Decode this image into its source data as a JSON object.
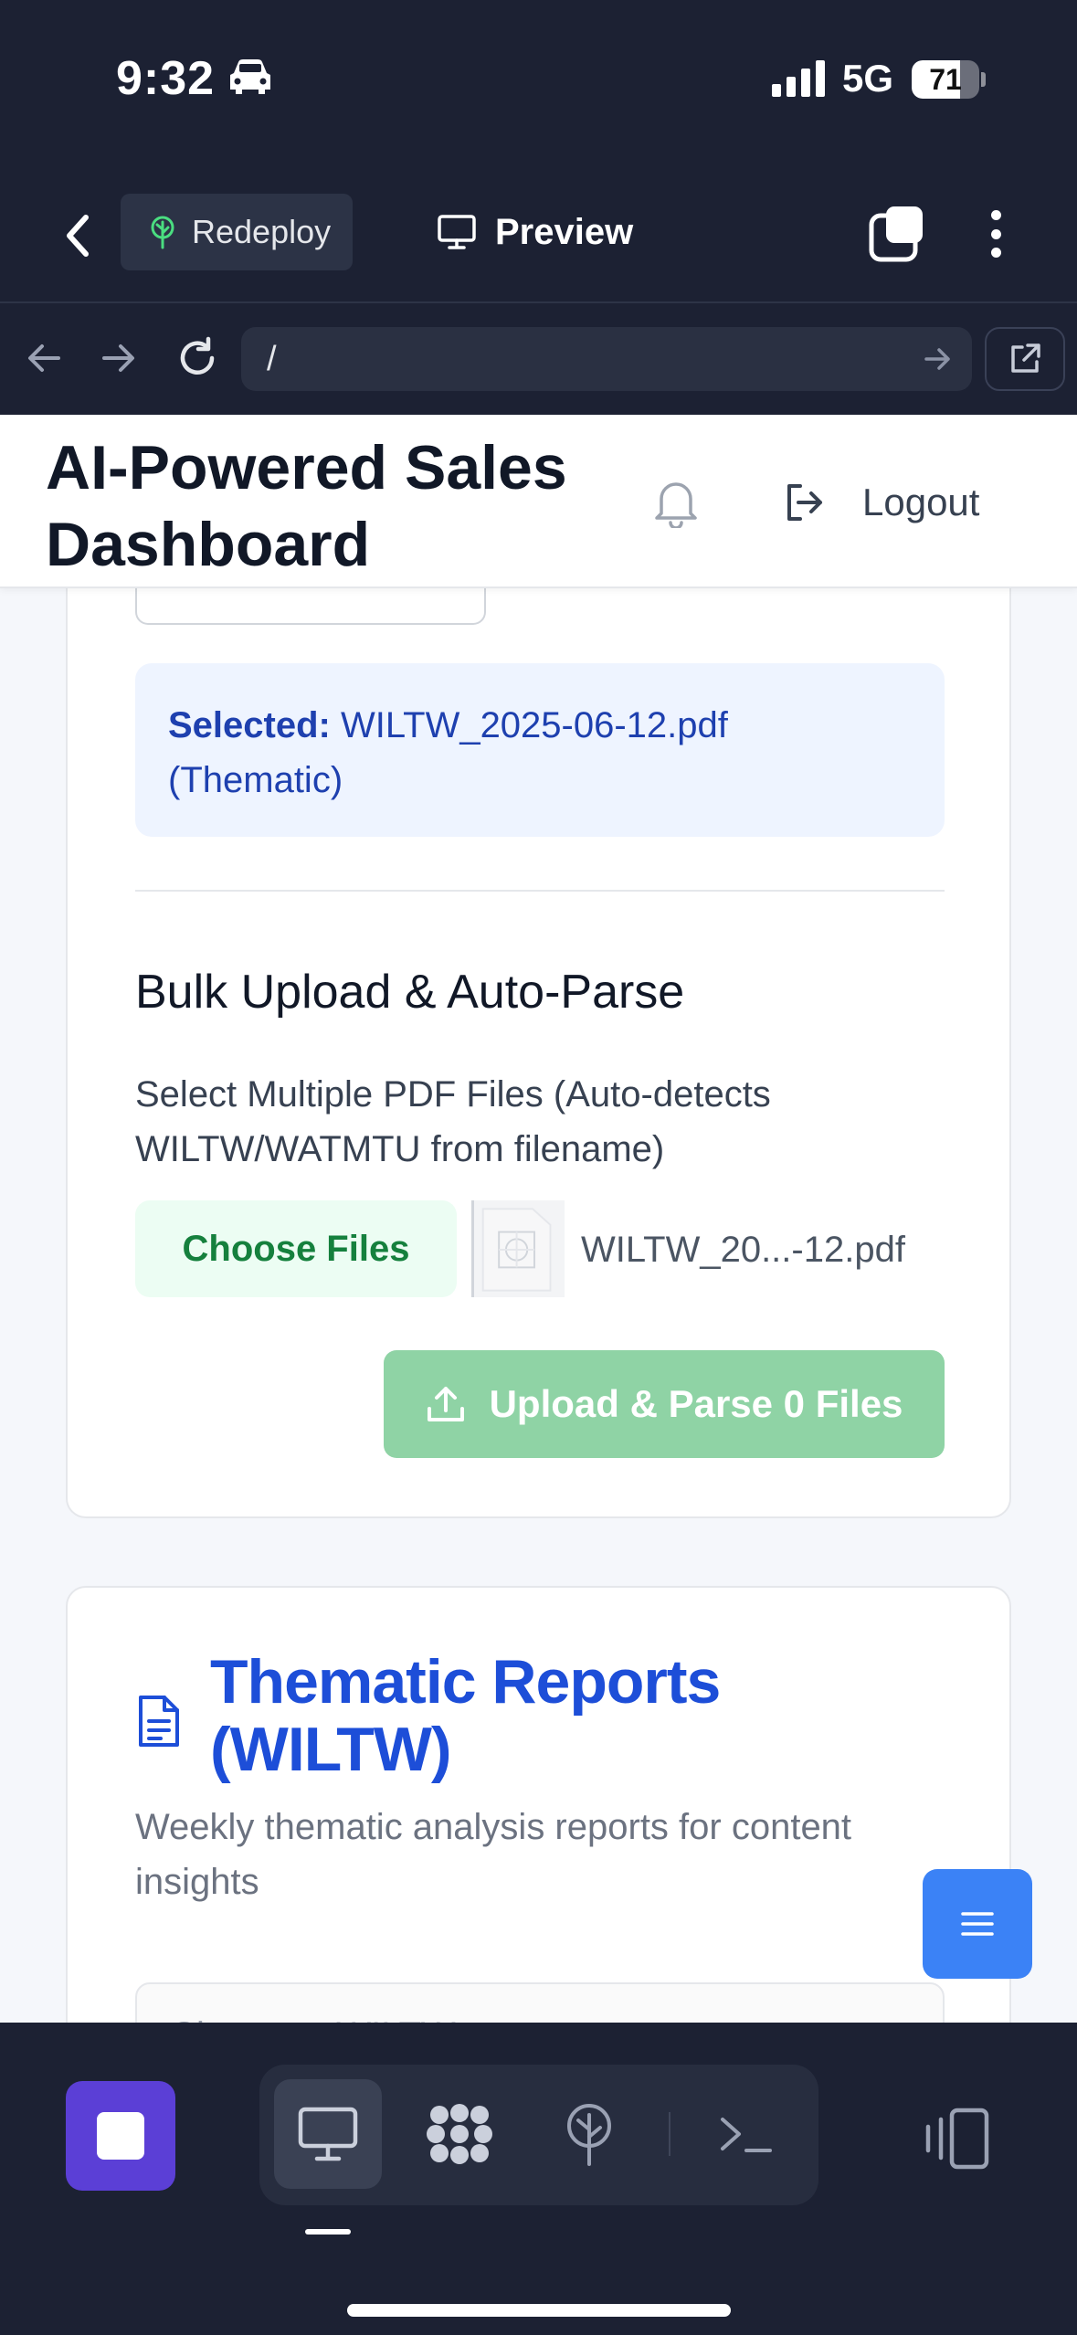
{
  "status_bar": {
    "time": "9:32",
    "network": "5G",
    "battery": "71",
    "battery_level": 0.71,
    "icons": [
      "car-icon",
      "signal-bars-icon",
      "battery-icon"
    ]
  },
  "toolbar": {
    "redeploy_label": "Redeploy",
    "preview_label": "Preview",
    "icons": [
      "chevron-left-icon",
      "tree-icon",
      "monitor-icon",
      "tabs-icon",
      "more-vertical-icon"
    ]
  },
  "browser": {
    "url": "/",
    "icons": [
      "arrow-left-icon",
      "arrow-right-icon",
      "reload-icon",
      "arrow-right-small-icon",
      "external-link-icon"
    ]
  },
  "header": {
    "title": "AI-Powered Sales Dashboard",
    "logout_label": "Logout",
    "icons": [
      "bell-icon",
      "logout-icon"
    ]
  },
  "upload_card": {
    "selected_label": "Selected:",
    "selected_value": "WILTW_2025-06-12.pdf (Thematic)",
    "bulk_title": "Bulk Upload & Auto-Parse",
    "bulk_label": "Select Multiple PDF Files (Auto-detects WILTW/WATMTU from filename)",
    "choose_files_label": "Choose Files",
    "file_name": "WILTW_20...-12.pdf",
    "upload_button_label": "Upload & Parse 0 Files"
  },
  "reports_card": {
    "title": "Thematic Reports (WILTW)",
    "description": "Weekly thematic analysis reports for content insights",
    "select_placeholder": "Choose a WILTW report..."
  },
  "colors": {
    "chrome_bg": "#1c2133",
    "accent_blue": "#1d4ed8",
    "fab_blue": "#3b82f6",
    "green_text": "#15803d",
    "upload_green": "#8fd3a5",
    "stop_purple": "#5b3fd6"
  },
  "bottom_bar": {
    "icons": [
      "stop-icon",
      "monitor-icon",
      "workspace-icon",
      "deploy-icon",
      "terminal-icon",
      "devices-icon"
    ]
  }
}
